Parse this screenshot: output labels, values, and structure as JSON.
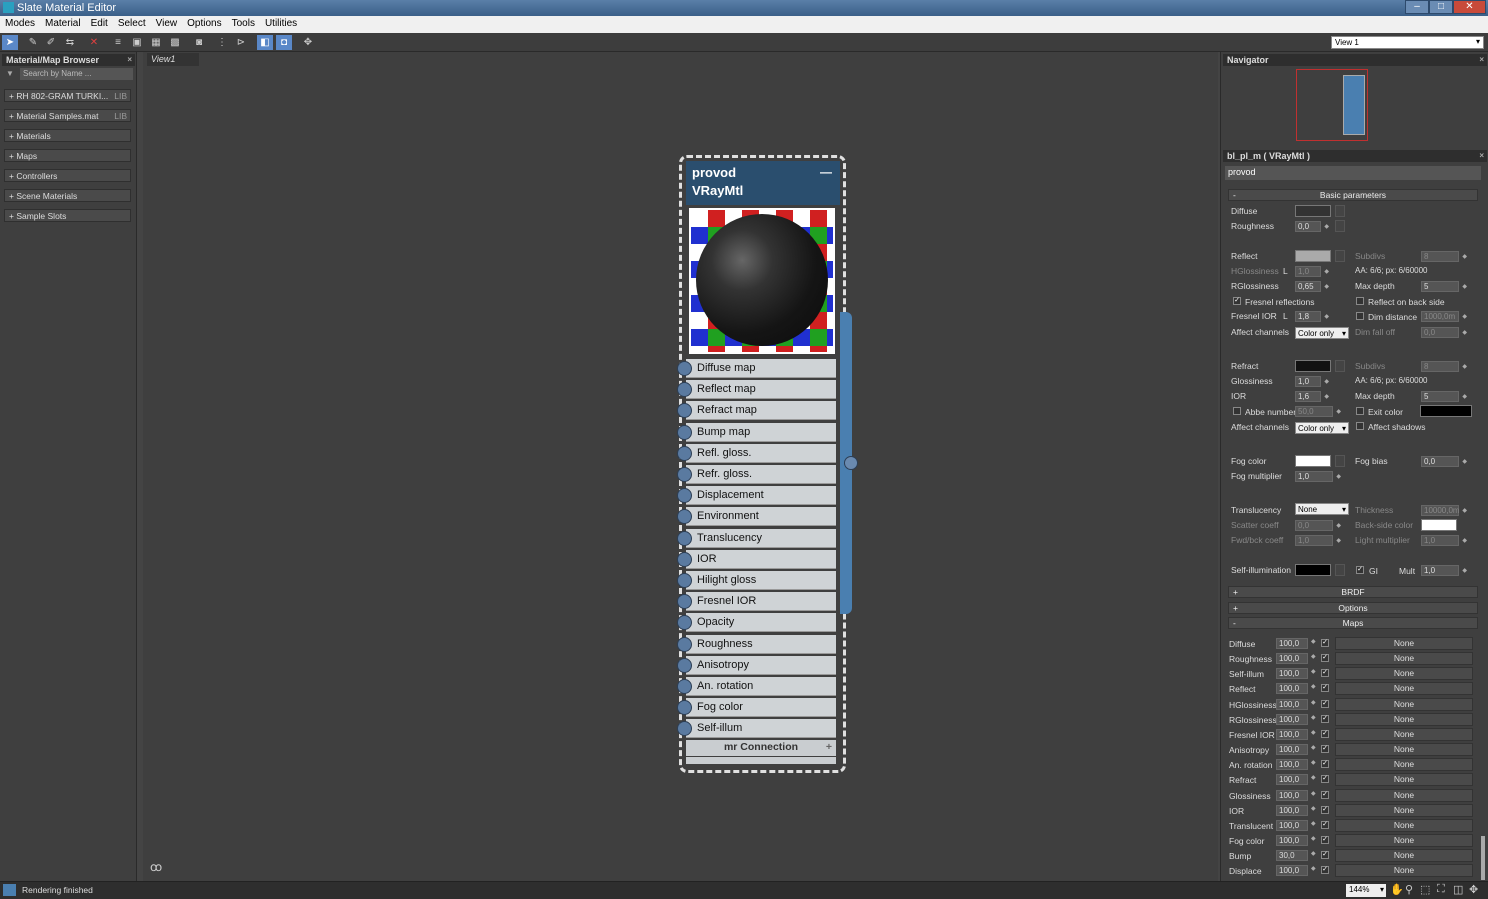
{
  "window": {
    "title": "Slate Material Editor",
    "buttons": [
      "–",
      "□",
      "✕"
    ]
  },
  "menu": [
    "Modes",
    "Material",
    "Edit",
    "Select",
    "View",
    "Options",
    "Tools",
    "Utilities"
  ],
  "toolbar": {
    "icons": [
      "select-tool",
      "eyedropper",
      "material-pick",
      "swap",
      "delete",
      "layout",
      "hide",
      "move-children",
      "grid",
      "render",
      "split",
      "arrows",
      "toggle-on",
      "toggle-box",
      "nav-icon"
    ],
    "view_selector": "View 1"
  },
  "browser": {
    "title": "Material/Map Browser",
    "close": "×",
    "search_placeholder": "Search by Name ...",
    "items": [
      {
        "label": "+ RH 802-GRAM TURKI...",
        "tag": "LIB"
      },
      {
        "label": "+ Material Samples.mat",
        "tag": "LIB"
      },
      {
        "label": "+ Materials",
        "tag": ""
      },
      {
        "label": "+ Maps",
        "tag": ""
      },
      {
        "label": "+ Controllers",
        "tag": ""
      },
      {
        "label": "+ Scene Materials",
        "tag": ""
      },
      {
        "label": "+ Sample Slots",
        "tag": ""
      }
    ]
  },
  "view": {
    "tab": "View1"
  },
  "node": {
    "name": "provod",
    "type": "VRayMtl",
    "minimize": "—",
    "slots": [
      "Diffuse map",
      "Reflect map",
      "Refract map",
      "Bump map",
      "Refl. gloss.",
      "Refr. gloss.",
      "Displacement",
      "Environment",
      "Translucency",
      "IOR",
      "Hilight gloss",
      "Fresnel IOR",
      "Opacity",
      "Roughness",
      "Anisotropy",
      "An. rotation",
      "Fog color",
      "Self-illum"
    ],
    "footer": "mr Connection",
    "footer_plus": "+"
  },
  "navigator": {
    "title": "Navigator",
    "close": "×"
  },
  "params": {
    "title": "bl_pl_m  ( VRayMtl )",
    "close": "×",
    "name_value": "provod",
    "basic": "Basic parameters",
    "collapse": "-",
    "expand": "+",
    "diffuse": "Diffuse",
    "roughness": "Roughness",
    "roughness_v": "0,0",
    "reflect": "Reflect",
    "subdivs": "Subdivs",
    "subdivs_v": "8",
    "hgloss": "HGlossiness",
    "L": "L",
    "hgloss_v": "1,0",
    "aa1": "AA: 6/6; px: 6/60000",
    "rgloss": "RGlossiness",
    "rgloss_v": "0,65",
    "maxdepth": "Max depth",
    "maxdepth_v": "5",
    "fresnel": "Fresnel reflections",
    "reflback": "Reflect on back side",
    "fior": "Fresnel IOR",
    "fior_v": "1,8",
    "dimdist": "Dim distance",
    "dimdist_v": "1000,0m",
    "affect": "Affect channels",
    "affect_v": "Color only",
    "dimfall": "Dim fall off",
    "dimfall_v": "0,0",
    "refract": "Refract",
    "rsubdivs_v": "8",
    "gloss": "Glossiness",
    "gloss_v": "1,0",
    "aa2": "AA: 6/6; px: 6/60000",
    "ior": "IOR",
    "ior_v": "1,6",
    "rmaxdepth_v": "5",
    "abbe": "Abbe number",
    "abbe_v": "50,0",
    "exitcolor": "Exit color",
    "affect2_v": "Color only",
    "affectshadows": "Affect shadows",
    "fogcolor": "Fog color",
    "fogbias": "Fog bias",
    "fogbias_v": "0,0",
    "fogmult": "Fog multiplier",
    "fogmult_v": "1,0",
    "transl": "Translucency",
    "transl_v": "None",
    "thick": "Thickness",
    "thick_v": "10000,0m",
    "scatter": "Scatter coeff",
    "scatter_v": "0,0",
    "backside": "Back-side color",
    "fwdbck": "Fwd/bck coeff",
    "fwdbck_v": "1,0",
    "lightmult": "Light multiplier",
    "lightmult_v": "1,0",
    "selfillum": "Self-illumination",
    "gi": "GI",
    "mult": "Mult",
    "mult_v": "1,0",
    "brdf": "BRDF",
    "options": "Options",
    "maps": "Maps",
    "check": "✓",
    "map_rows": [
      {
        "l": "Diffuse",
        "v": "100,0",
        "m": "None"
      },
      {
        "l": "Roughness",
        "v": "100,0",
        "m": "None"
      },
      {
        "l": "Self-illum",
        "v": "100,0",
        "m": "None"
      },
      {
        "l": "Reflect",
        "v": "100,0",
        "m": "None"
      },
      {
        "l": "HGlossiness",
        "v": "100,0",
        "m": "None"
      },
      {
        "l": "RGlossiness",
        "v": "100,0",
        "m": "None"
      },
      {
        "l": "Fresnel IOR",
        "v": "100,0",
        "m": "None"
      },
      {
        "l": "Anisotropy",
        "v": "100,0",
        "m": "None"
      },
      {
        "l": "An. rotation",
        "v": "100,0",
        "m": "None"
      },
      {
        "l": "Refract",
        "v": "100,0",
        "m": "None"
      },
      {
        "l": "Glossiness",
        "v": "100,0",
        "m": "None"
      },
      {
        "l": "IOR",
        "v": "100,0",
        "m": "None"
      },
      {
        "l": "Translucent",
        "v": "100,0",
        "m": "None"
      },
      {
        "l": "Fog color",
        "v": "100,0",
        "m": "None"
      },
      {
        "l": "Bump",
        "v": "30,0",
        "m": "None"
      },
      {
        "l": "Displace",
        "v": "100,0",
        "m": "None"
      }
    ]
  },
  "status": {
    "text": "Rendering finished",
    "zoom": "144%"
  },
  "colors": {
    "accent": "#4a7fb0",
    "node_header": "#2a4e6e",
    "reflect_swatch": "#aaaaaa",
    "refract_swatch": "#111111",
    "fog_swatch": "#ffffff"
  }
}
